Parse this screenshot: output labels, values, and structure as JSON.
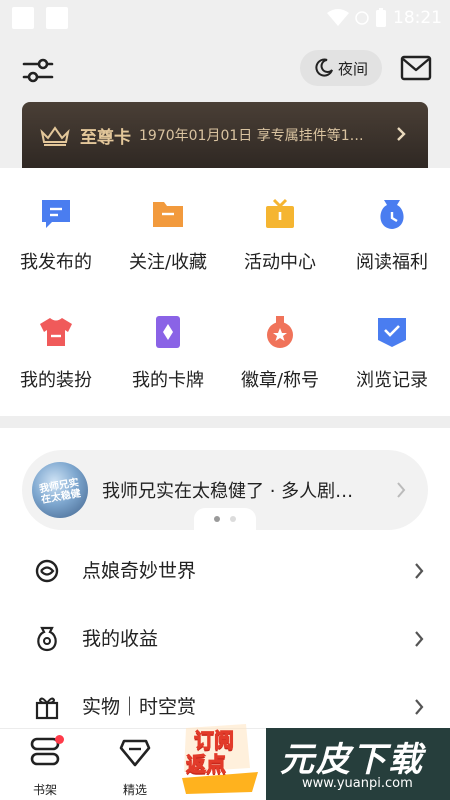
{
  "status_bar": {
    "time": "18:21"
  },
  "header": {
    "night_label": "夜间"
  },
  "vip": {
    "title": "至尊卡",
    "desc": "1970年01月01日 享专属挂件等1…"
  },
  "grid": {
    "items": [
      {
        "label": "我发布的",
        "icon": "message-icon",
        "color": "#4a7df0"
      },
      {
        "label": "关注/收藏",
        "icon": "folder-icon",
        "color": "#f29a3d"
      },
      {
        "label": "活动中心",
        "icon": "gift-icon",
        "color": "#f5b531"
      },
      {
        "label": "阅读福利",
        "icon": "clock-bag-icon",
        "color": "#4a7df0"
      },
      {
        "label": "我的装扮",
        "icon": "tshirt-icon",
        "color": "#f05a5a"
      },
      {
        "label": "我的卡牌",
        "icon": "card-icon",
        "color": "#8a63e6"
      },
      {
        "label": "徽章/称号",
        "icon": "medal-icon",
        "color": "#f0735a"
      },
      {
        "label": "浏览记录",
        "icon": "history-icon",
        "color": "#4a7df0"
      }
    ]
  },
  "banner": {
    "title": "我师兄实在太稳健了 · 多人剧…",
    "cover_text": "我师兄实在太稳健"
  },
  "menu": {
    "items": [
      {
        "label": "点娘奇妙世界",
        "icon": "world-icon"
      },
      {
        "label": "我的收益",
        "icon": "income-icon"
      },
      {
        "label": "实物｜时空赏",
        "icon": "gift-box-icon"
      }
    ]
  },
  "tabbar": {
    "items": [
      {
        "label": "书架",
        "icon": "bookshelf-icon"
      },
      {
        "label": "精选",
        "icon": "diamond-icon"
      }
    ],
    "promo": {
      "line1": "订阅",
      "line2": "返点"
    }
  },
  "watermark": {
    "main": "元皮下载",
    "sub": "www.yuanpi.com"
  },
  "colors": {
    "accent_red": "#ff3b4a",
    "vip_gold": "#e3c79a",
    "vip_bg": "#2f2823"
  }
}
